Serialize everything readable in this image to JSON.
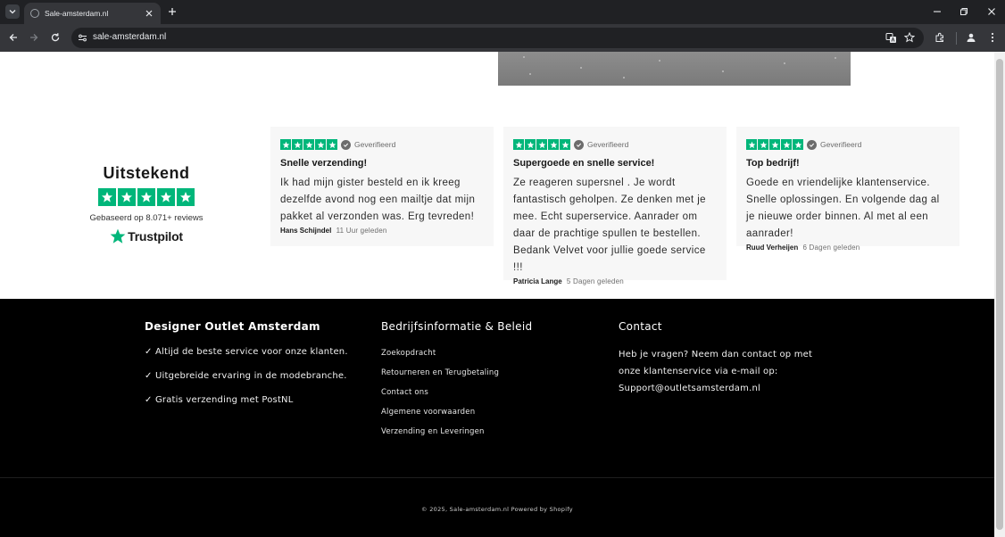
{
  "browser": {
    "tab_title": "Sale-amsterdam.nl",
    "url": "sale-amsterdam.nl"
  },
  "trustpilot": {
    "heading": "Uitstekend",
    "rating_stars": 5,
    "based_on": "Gebaseerd op 8.071+ reviews",
    "logo_text": "Trustpilot",
    "brand_color": "#00b67a"
  },
  "reviews": [
    {
      "stars": 5,
      "verified": "Geverifieerd",
      "title": "Snelle verzending!",
      "text": "Ik had mijn gister besteld en ik kreeg dezelfde avond nog een mailtje dat mijn pakket al verzonden was. Erg tevreden!",
      "author": "Hans Schijndel",
      "date": "11 Uur geleden"
    },
    {
      "stars": 5,
      "verified": "Geverifieerd",
      "title": "Supergoede en snelle service!",
      "text": "Ze reageren supersnel . Je wordt fantastisch geholpen. Ze denken met je mee. Echt superservice. Aanrader om daar de prachtige spullen te bestellen. Bedank Velvet voor jullie goede service !!!",
      "author": "Patricia Lange",
      "date": "5 Dagen geleden"
    },
    {
      "stars": 5,
      "verified": "Geverifieerd",
      "title": "Top bedrijf!",
      "text": "Goede en vriendelijke klantenservice. Snelle oplossingen. En volgende dag al je nieuwe order binnen. Al met al een aanrader!",
      "author": "Ruud Verheijen",
      "date": "6 Dagen geleden"
    }
  ],
  "footer": {
    "col1": {
      "heading": "Designer Outlet Amsterdam",
      "usps": [
        "✓ Altijd de beste service voor onze klanten.",
        "✓ Uitgebreide ervaring in de modebranche.",
        "✓ Gratis verzending met PostNL"
      ]
    },
    "col2": {
      "heading": "Bedrijfsinformatie & Beleid",
      "links": [
        "Zoekopdracht",
        "Retourneren en Terugbetaling",
        "Contact ons",
        "Algemene voorwaarden",
        "Verzending en Leveringen"
      ]
    },
    "col3": {
      "heading": "Contact",
      "text": "Heb je vragen? Neem dan contact op met onze klantenservice via e-mail op: Support@outletsamsterdam.nl"
    },
    "copyright": "© 2025, Sale-amsterdam.nl Powered by Shopify"
  }
}
